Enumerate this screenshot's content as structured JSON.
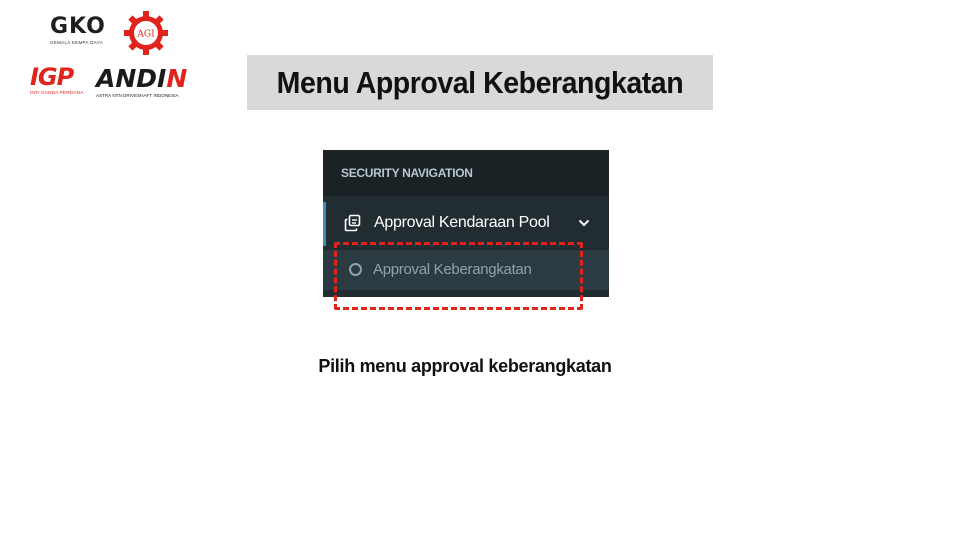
{
  "logos": {
    "gko": {
      "mark": "GKO",
      "tagline": "GEMALA KEMPA DAYA"
    },
    "agi": {
      "mark": "AGI"
    },
    "igp": {
      "mark": "IGP",
      "tagline": "INTI GANDA PERDANA"
    },
    "andin": {
      "mark_dark": "ANDI",
      "mark_red": "N",
      "tagline": "ASTRA NTN DRIVESHAFT INDONESIA"
    }
  },
  "slide": {
    "title": "Menu Approval Keberangkatan",
    "caption": "Pilih menu approval keberangkatan"
  },
  "sidebar": {
    "section_header": "SECURITY NAVIGATION",
    "parent_item": {
      "label": "Approval Kendaraan Pool",
      "icon": "copy-icon",
      "expanded": true
    },
    "child_item": {
      "label": "Approval Keberangkatan",
      "icon": "circle-icon"
    }
  },
  "colors": {
    "sidebar_bg": "#222d32",
    "header_bg": "#1a2226",
    "active_border": "#3c8dbc",
    "highlight": "#e0241b",
    "title_bg": "#d9d9d9"
  }
}
